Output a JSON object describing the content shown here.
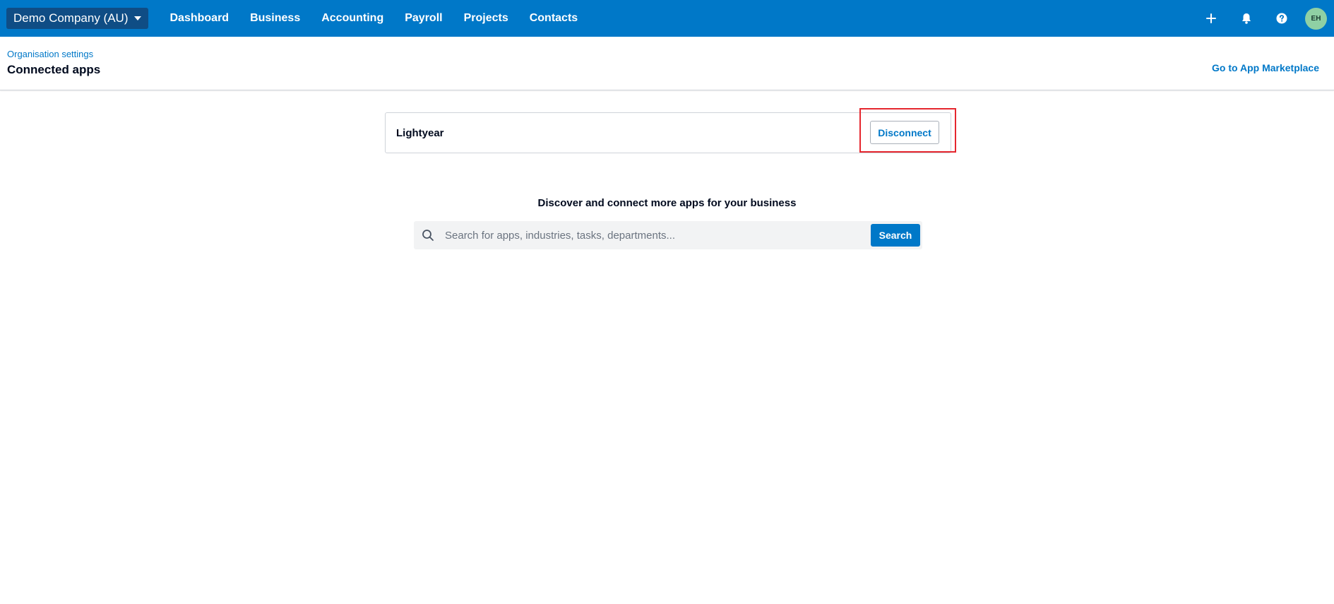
{
  "topbar": {
    "org_name": "Demo Company (AU)",
    "nav": [
      "Dashboard",
      "Business",
      "Accounting",
      "Payroll",
      "Projects",
      "Contacts"
    ],
    "avatar_initials": "EH",
    "icons": [
      "plus-icon",
      "bell-icon",
      "help-icon"
    ]
  },
  "header": {
    "breadcrumb": "Organisation settings",
    "title": "Connected apps",
    "marketplace_link": "Go to App Marketplace"
  },
  "connected_app": {
    "name": "Lightyear",
    "disconnect_label": "Disconnect"
  },
  "discover": {
    "title": "Discover and connect more apps for your business",
    "search_placeholder": "Search for apps, industries, tasks, departments...",
    "search_button": "Search"
  },
  "colors": {
    "brand_blue": "#0078c8",
    "org_switcher_bg": "#0f4d85",
    "highlight_red": "#e5262e",
    "avatar_green": "#8fd0a4"
  }
}
